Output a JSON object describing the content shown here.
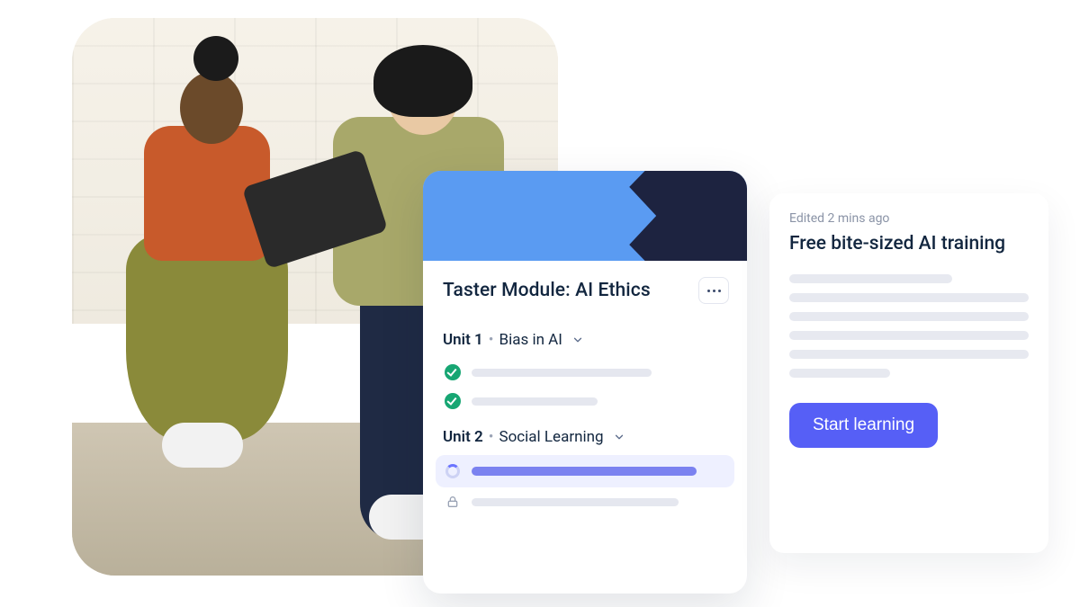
{
  "module": {
    "title": "Taster Module: AI Ethics",
    "units": [
      {
        "number_label": "Unit 1",
        "name": "Bias in AI",
        "lessons": [
          {
            "status": "complete"
          },
          {
            "status": "complete"
          }
        ]
      },
      {
        "number_label": "Unit 2",
        "name": "Social Learning",
        "lessons": [
          {
            "status": "in_progress"
          },
          {
            "status": "locked"
          }
        ]
      }
    ]
  },
  "side": {
    "edited_label": "Edited 2 mins ago",
    "title": "Free bite-sized AI training",
    "cta_label": "Start learning"
  },
  "colors": {
    "accent": "#565ff6",
    "success": "#17a673",
    "banner_light": "#5a9bf2",
    "banner_dark": "#1d2340"
  }
}
